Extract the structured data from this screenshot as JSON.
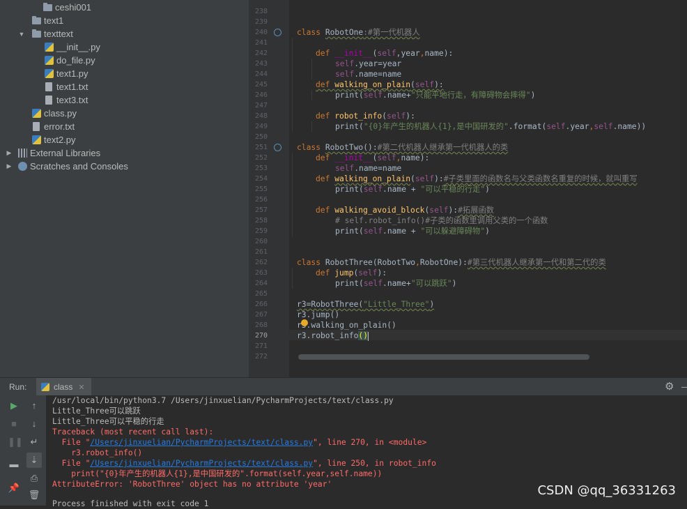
{
  "project_tree": [
    {
      "label": "ceshi001",
      "icon": "folder-icon"
    },
    {
      "label": "text1",
      "icon": "folder-icon"
    },
    {
      "label": "texttext",
      "icon": "folder-icon",
      "expanded": true
    },
    {
      "label": "__init__.py",
      "icon": "python-file-icon"
    },
    {
      "label": "do_file.py",
      "icon": "python-file-icon"
    },
    {
      "label": "text1.py",
      "icon": "python-file-icon"
    },
    {
      "label": "text1.txt",
      "icon": "text-file-icon"
    },
    {
      "label": "text3.txt",
      "icon": "text-file-icon"
    },
    {
      "label": "class.py",
      "icon": "python-file-icon"
    },
    {
      "label": "error.txt",
      "icon": "text-file-icon"
    },
    {
      "label": "text2.py",
      "icon": "python-file-icon"
    },
    {
      "label": "External Libraries",
      "icon": "libraries-icon",
      "expanded": false
    },
    {
      "label": "Scratches and Consoles",
      "icon": "scratches-icon",
      "expanded": false
    }
  ],
  "editor": {
    "line_numbers": [
      "238",
      "239",
      "240",
      "241",
      "242",
      "243",
      "244",
      "245",
      "246",
      "247",
      "248",
      "249",
      "250",
      "251",
      "252",
      "253",
      "254",
      "255",
      "256",
      "257",
      "258",
      "259",
      "260",
      "261",
      "262",
      "263",
      "264",
      "265",
      "266",
      "267",
      "268",
      "269",
      "270",
      "271",
      "272"
    ],
    "current_line": "270",
    "code": {
      "l241": [
        "class",
        " ",
        "RobotOne",
        ":#第一代机器人"
      ],
      "l243": [
        "def",
        " ",
        "__init__",
        "(",
        "self",
        ",year",
        ",",
        "name):"
      ],
      "l244": [
        "self",
        ".year=year"
      ],
      "l245": [
        "self",
        ".name=name"
      ],
      "l246": [
        "def",
        " ",
        "walking_on_plain",
        "(",
        "self",
        "):"
      ],
      "l247": [
        "print(",
        "self",
        ".name+",
        "\"只能平地行走，有障碍物会摔得\"",
        ")"
      ],
      "l249": [
        "def",
        " ",
        "robot_info",
        "(",
        "self",
        "):"
      ],
      "l250": [
        "print(",
        "\"{0}年产生的机器人{1},是中国研发的\"",
        ".format(",
        "self",
        ".year",
        ",",
        "self",
        ".name))"
      ],
      "l252": [
        "class",
        " ",
        "RobotTwo():",
        "#第二代机器人继承第一代机器人的类"
      ],
      "l253": [
        "def",
        " ",
        "__init__",
        "(",
        "self",
        ",",
        "name):"
      ],
      "l254": [
        "self",
        ".name=name"
      ],
      "l255": [
        "def",
        " ",
        "walking_on_plain",
        "(",
        "self",
        "):",
        "#子类里面的函数名与父类函数名重复的时候，就叫重写"
      ],
      "l256": [
        "print(",
        "self",
        ".name + ",
        "\"可以平稳的行走\"",
        ")"
      ],
      "l258": [
        "def",
        " ",
        "walking_avoid_block",
        "(",
        "self",
        "):",
        "#拓展函数"
      ],
      "l259": [
        "# self.robot_info()#子类的函数里调用父类的一个函数"
      ],
      "l260": [
        "print(",
        "self",
        ".name + ",
        "\"可以躲避障碍物\"",
        ")"
      ],
      "l263": [
        "class",
        " ",
        "RobotThree(RobotTwo",
        ",",
        "RobotOne):",
        "#第三代机器人继承第一代和第二代的类"
      ],
      "l264": [
        "def",
        " ",
        "jump",
        "(",
        "self",
        "):"
      ],
      "l265": [
        "print(",
        "self",
        ".name+",
        "\"可以跳跃\"",
        ")"
      ],
      "l267": [
        "r3=RobotThree(",
        "\"Little_Three\"",
        ")"
      ],
      "l268": [
        "r3.jump()"
      ],
      "l269": [
        "r3.walking_on_plain()"
      ],
      "l270": [
        "r3.robot_info",
        "()"
      ]
    }
  },
  "run_panel": {
    "label": "Run:",
    "tab": "class",
    "output": [
      "/usr/local/bin/python3.7 /Users/jinxuelian/PycharmProjects/text/class.py",
      "Little_Three可以跳跃",
      "Little_Three可以平稳的行走",
      "Traceback (most recent call last):",
      "  File \"",
      "/Users/jinxuelian/PycharmProjects/text/class.py",
      "\", line 270, in <module>",
      "    r3.robot_info()",
      "  File \"",
      "/Users/jinxuelian/PycharmProjects/text/class.py",
      "\", line 250, in robot_info",
      "    print(\"{0}年产生的机器人{1},是中国研发的\".format(self.year,self.name))",
      "AttributeError: 'RobotThree' object has no attribute 'year'",
      "",
      "Process finished with exit code 1"
    ]
  },
  "watermark": "CSDN @qq_36331263",
  "colors": {
    "keyword": "#cc7832",
    "function": "#ffc66d",
    "self": "#94558d",
    "string": "#6a8759",
    "comment": "#808080",
    "error": "#ff6b68",
    "link": "#287bde"
  }
}
